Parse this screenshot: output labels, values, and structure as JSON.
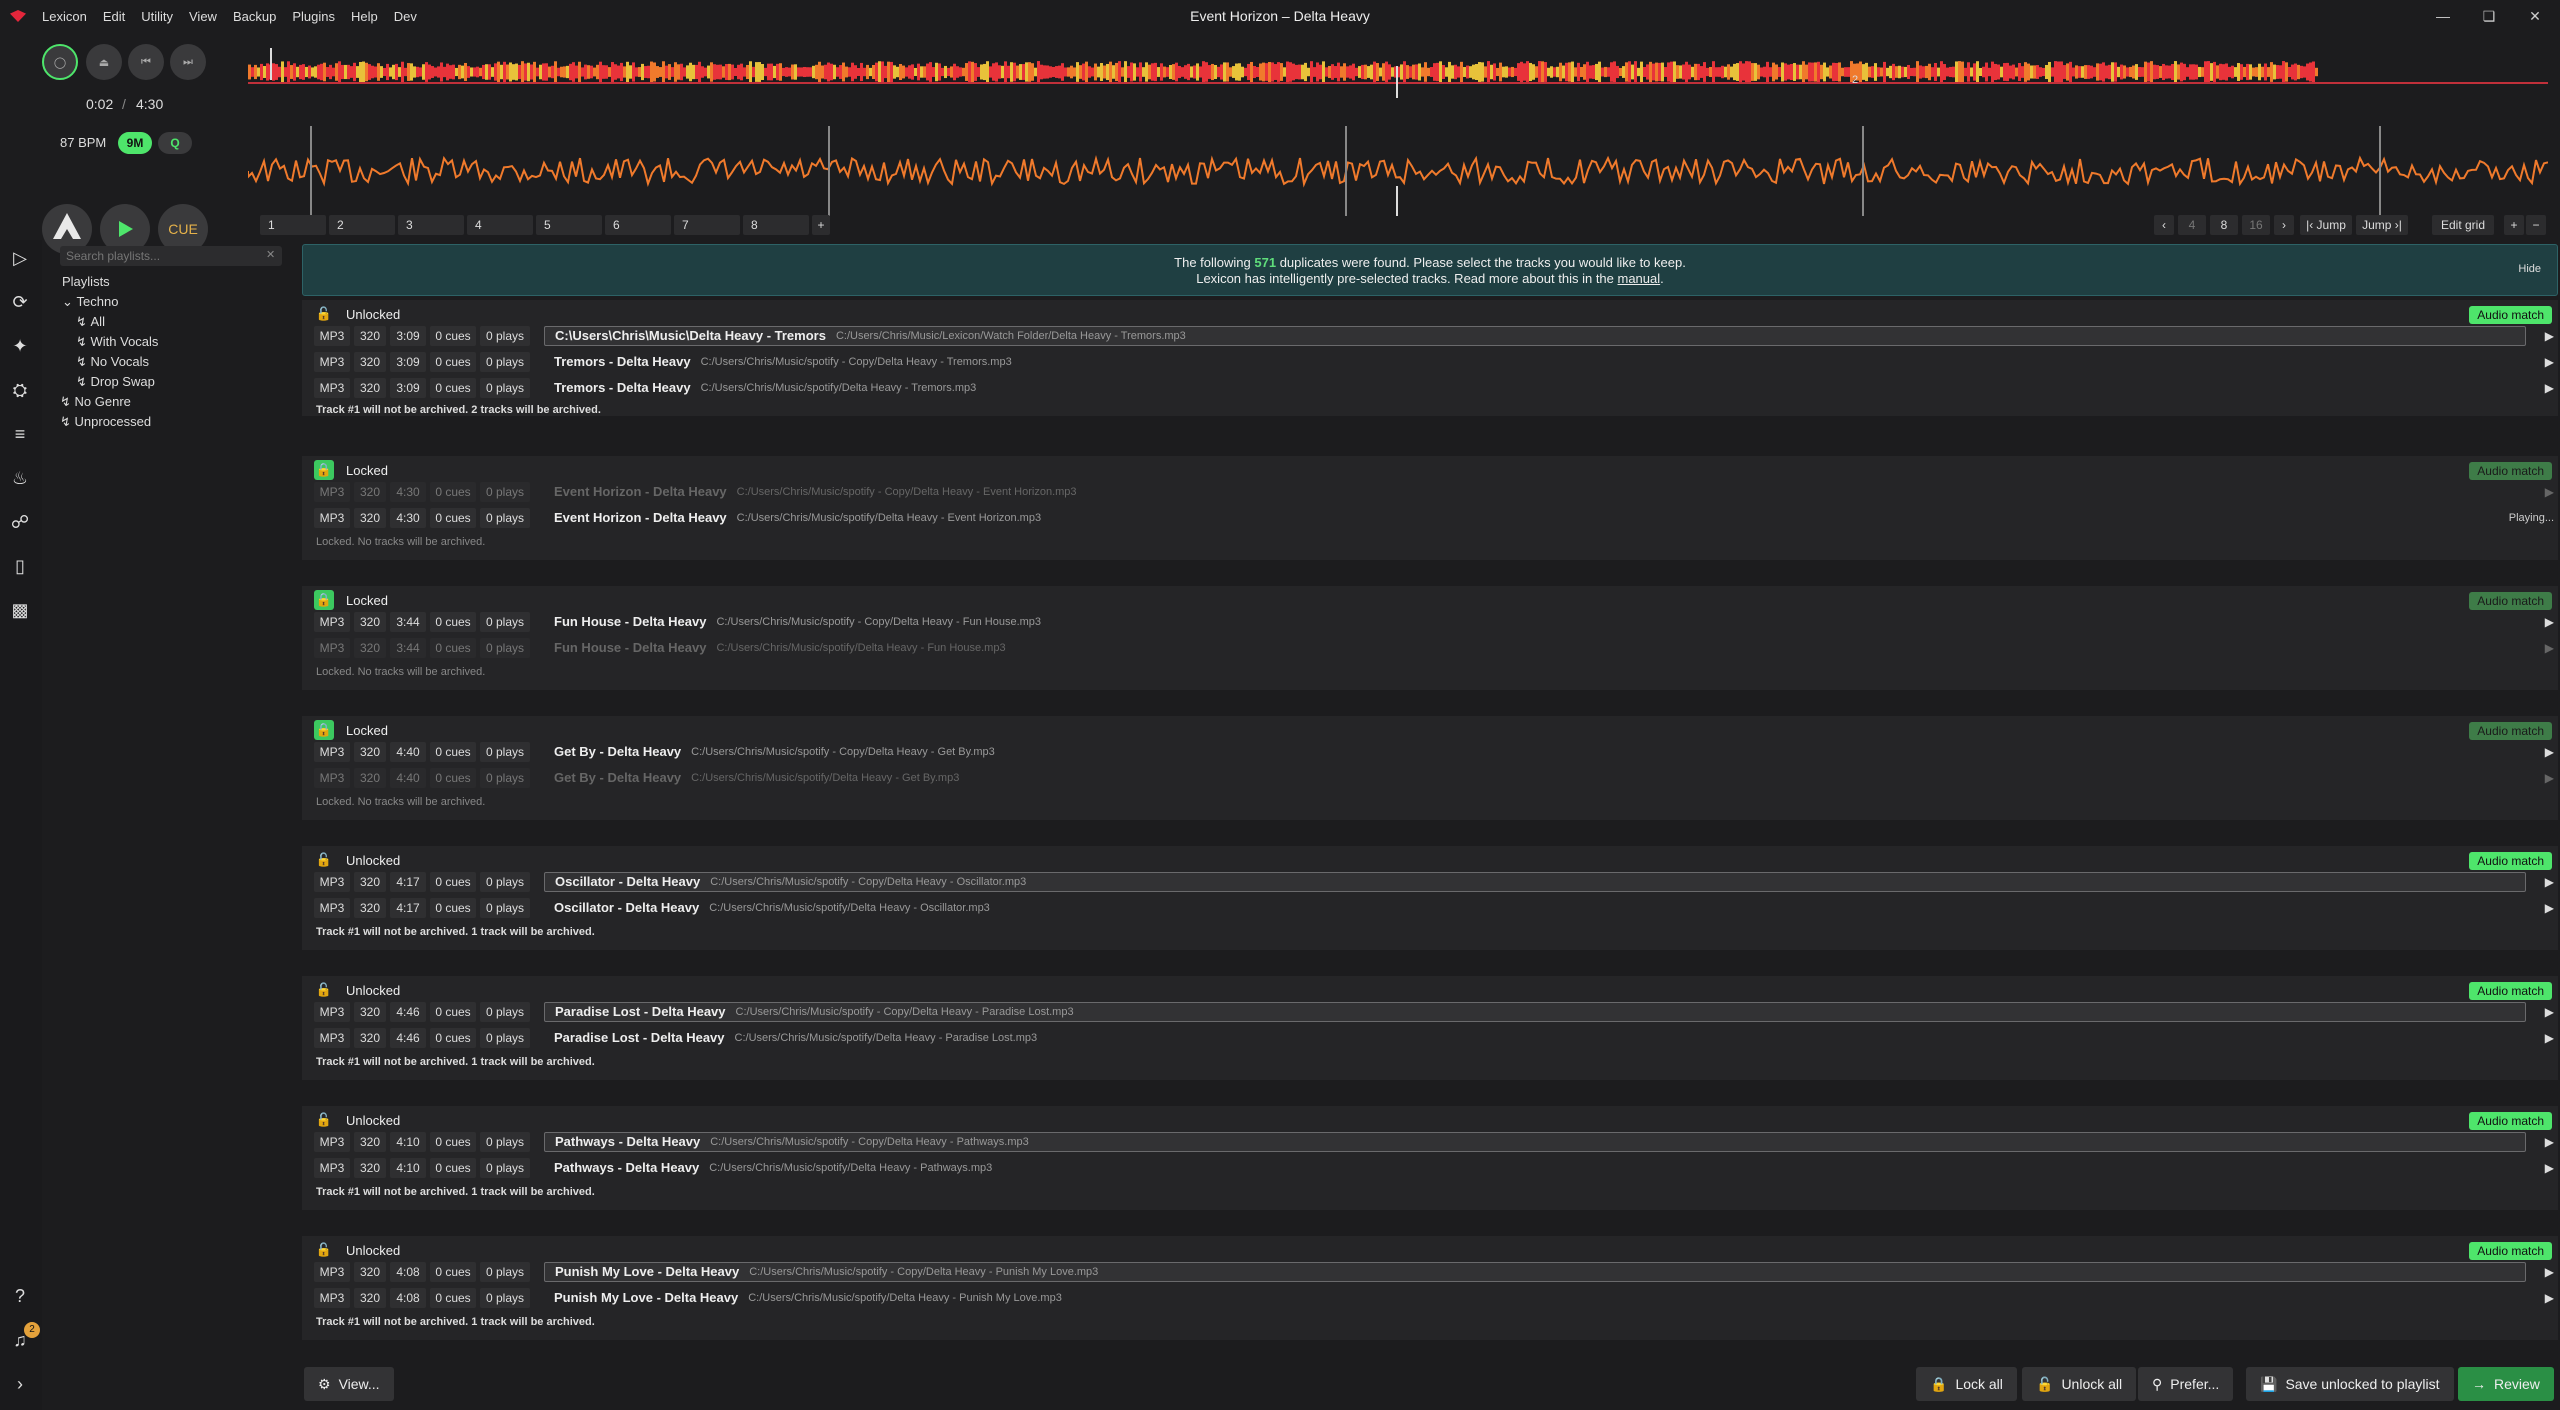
{
  "window": {
    "title": "Event Horizon – Delta Heavy"
  },
  "menu": [
    "Lexicon",
    "Edit",
    "Utility",
    "View",
    "Backup",
    "Plugins",
    "Help",
    "Dev"
  ],
  "player": {
    "elapsed": "0:02",
    "separator": "/",
    "duration": "4:30",
    "bpm": "87 BPM",
    "key": "9M",
    "quantize": "Q",
    "cue_label": "CUE",
    "beat_marker": "2"
  },
  "hotcues": [
    "1",
    "2",
    "3",
    "4",
    "5",
    "6",
    "7",
    "8"
  ],
  "hotcue_add": "+",
  "beatjump": {
    "values": [
      "4",
      "8",
      "16"
    ],
    "jump_back": "Jump",
    "jump_fwd": "Jump",
    "edit_grid": "Edit grid"
  },
  "sidebar": {
    "search_placeholder": "Search playlists...",
    "heading": "Playlists",
    "items": [
      {
        "label": "Techno",
        "level": 0
      },
      {
        "label": "All",
        "level": 1
      },
      {
        "label": "With Vocals",
        "level": 1
      },
      {
        "label": "No Vocals",
        "level": 1
      },
      {
        "label": "Drop Swap",
        "level": 1
      },
      {
        "label": "No Genre",
        "level": 0
      },
      {
        "label": "Unprocessed",
        "level": 0
      }
    ]
  },
  "banner": {
    "line1_pre": "The following ",
    "count": "571",
    "line1_post": " duplicates were found. Please select the tracks you would like to keep.",
    "line2_pre": "Lexicon has intelligently pre-selected tracks. Read more about this in the ",
    "link": "manual",
    "line2_post": ".",
    "hide": "Hide"
  },
  "match_label": "Audio match",
  "groups": [
    {
      "state": "Unlocked",
      "status": "Track #1 will not be archived. 2 tracks will be archived.",
      "tracks": [
        {
          "fmt": "MP3",
          "br": "320",
          "len": "3:09",
          "cues": "0 cues",
          "plays": "0 plays",
          "title": "C:\\Users\\Chris\\Music\\Delta Heavy - Tremors",
          "path": "C:/Users/Chris/Music/Lexicon/Watch Folder/Delta Heavy - Tremors.mp3"
        },
        {
          "fmt": "MP3",
          "br": "320",
          "len": "3:09",
          "cues": "0 cues",
          "plays": "0 plays",
          "title": "Tremors - Delta Heavy",
          "path": "C:/Users/Chris/Music/spotify - Copy/Delta Heavy - Tremors.mp3"
        },
        {
          "fmt": "MP3",
          "br": "320",
          "len": "3:09",
          "cues": "0 cues",
          "plays": "0 plays",
          "title": "Tremors - Delta Heavy",
          "path": "C:/Users/Chris/Music/spotify/Delta Heavy - Tremors.mp3"
        }
      ]
    },
    {
      "state": "Locked",
      "status": "Locked. No tracks will be archived.",
      "tracks": [
        {
          "fmt": "MP3",
          "br": "320",
          "len": "4:30",
          "cues": "0 cues",
          "plays": "0 plays",
          "title": "Event Horizon - Delta Heavy",
          "path": "C:/Users/Chris/Music/spotify - Copy/Delta Heavy - Event Horizon.mp3"
        },
        {
          "fmt": "MP3",
          "br": "320",
          "len": "4:30",
          "cues": "0 cues",
          "plays": "0 plays",
          "title": "Event Horizon - Delta Heavy",
          "path": "C:/Users/Chris/Music/spotify/Delta Heavy - Event Horizon.mp3",
          "playing": "Playing..."
        }
      ]
    },
    {
      "state": "Locked",
      "status": "Locked. No tracks will be archived.",
      "tracks": [
        {
          "fmt": "MP3",
          "br": "320",
          "len": "3:44",
          "cues": "0 cues",
          "plays": "0 plays",
          "title": "Fun House - Delta Heavy",
          "path": "C:/Users/Chris/Music/spotify - Copy/Delta Heavy - Fun House.mp3"
        },
        {
          "fmt": "MP3",
          "br": "320",
          "len": "3:44",
          "cues": "0 cues",
          "plays": "0 plays",
          "title": "Fun House - Delta Heavy",
          "path": "C:/Users/Chris/Music/spotify/Delta Heavy - Fun House.mp3"
        }
      ]
    },
    {
      "state": "Locked",
      "status": "Locked. No tracks will be archived.",
      "tracks": [
        {
          "fmt": "MP3",
          "br": "320",
          "len": "4:40",
          "cues": "0 cues",
          "plays": "0 plays",
          "title": "Get By - Delta Heavy",
          "path": "C:/Users/Chris/Music/spotify - Copy/Delta Heavy - Get By.mp3"
        },
        {
          "fmt": "MP3",
          "br": "320",
          "len": "4:40",
          "cues": "0 cues",
          "plays": "0 plays",
          "title": "Get By - Delta Heavy",
          "path": "C:/Users/Chris/Music/spotify/Delta Heavy - Get By.mp3"
        }
      ]
    },
    {
      "state": "Unlocked",
      "status": "Track #1 will not be archived. 1 track will be archived.",
      "tracks": [
        {
          "fmt": "MP3",
          "br": "320",
          "len": "4:17",
          "cues": "0 cues",
          "plays": "0 plays",
          "title": "Oscillator - Delta Heavy",
          "path": "C:/Users/Chris/Music/spotify - Copy/Delta Heavy - Oscillator.mp3"
        },
        {
          "fmt": "MP3",
          "br": "320",
          "len": "4:17",
          "cues": "0 cues",
          "plays": "0 plays",
          "title": "Oscillator - Delta Heavy",
          "path": "C:/Users/Chris/Music/spotify/Delta Heavy - Oscillator.mp3"
        }
      ]
    },
    {
      "state": "Unlocked",
      "status": "Track #1 will not be archived. 1 track will be archived.",
      "tracks": [
        {
          "fmt": "MP3",
          "br": "320",
          "len": "4:46",
          "cues": "0 cues",
          "plays": "0 plays",
          "title": "Paradise Lost - Delta Heavy",
          "path": "C:/Users/Chris/Music/spotify - Copy/Delta Heavy - Paradise Lost.mp3"
        },
        {
          "fmt": "MP3",
          "br": "320",
          "len": "4:46",
          "cues": "0 cues",
          "plays": "0 plays",
          "title": "Paradise Lost - Delta Heavy",
          "path": "C:/Users/Chris/Music/spotify/Delta Heavy - Paradise Lost.mp3"
        }
      ]
    },
    {
      "state": "Unlocked",
      "status": "Track #1 will not be archived. 1 track will be archived.",
      "tracks": [
        {
          "fmt": "MP3",
          "br": "320",
          "len": "4:10",
          "cues": "0 cues",
          "plays": "0 plays",
          "title": "Pathways - Delta Heavy",
          "path": "C:/Users/Chris/Music/spotify - Copy/Delta Heavy - Pathways.mp3"
        },
        {
          "fmt": "MP3",
          "br": "320",
          "len": "4:10",
          "cues": "0 cues",
          "plays": "0 plays",
          "title": "Pathways - Delta Heavy",
          "path": "C:/Users/Chris/Music/spotify/Delta Heavy - Pathways.mp3"
        }
      ]
    },
    {
      "state": "Unlocked",
      "status": "Track #1 will not be archived. 1 track will be archived.",
      "tracks": [
        {
          "fmt": "MP3",
          "br": "320",
          "len": "4:08",
          "cues": "0 cues",
          "plays": "0 plays",
          "title": "Punish My Love - Delta Heavy",
          "path": "C:/Users/Chris/Music/spotify - Copy/Delta Heavy - Punish My Love.mp3"
        },
        {
          "fmt": "MP3",
          "br": "320",
          "len": "4:08",
          "cues": "0 cues",
          "plays": "0 plays",
          "title": "Punish My Love - Delta Heavy",
          "path": "C:/Users/Chris/Music/spotify/Delta Heavy - Punish My Love.mp3"
        }
      ]
    }
  ],
  "notifications_count": "2",
  "footer": {
    "view": "View...",
    "lock_all": "Lock all",
    "unlock_all": "Unlock all",
    "prefer": "Prefer...",
    "save": "Save unlocked to playlist",
    "review": "Review"
  },
  "colors": {
    "accent": "#4ee56b",
    "brand": "#e3263b",
    "banner_bg": "#1f3f42"
  }
}
